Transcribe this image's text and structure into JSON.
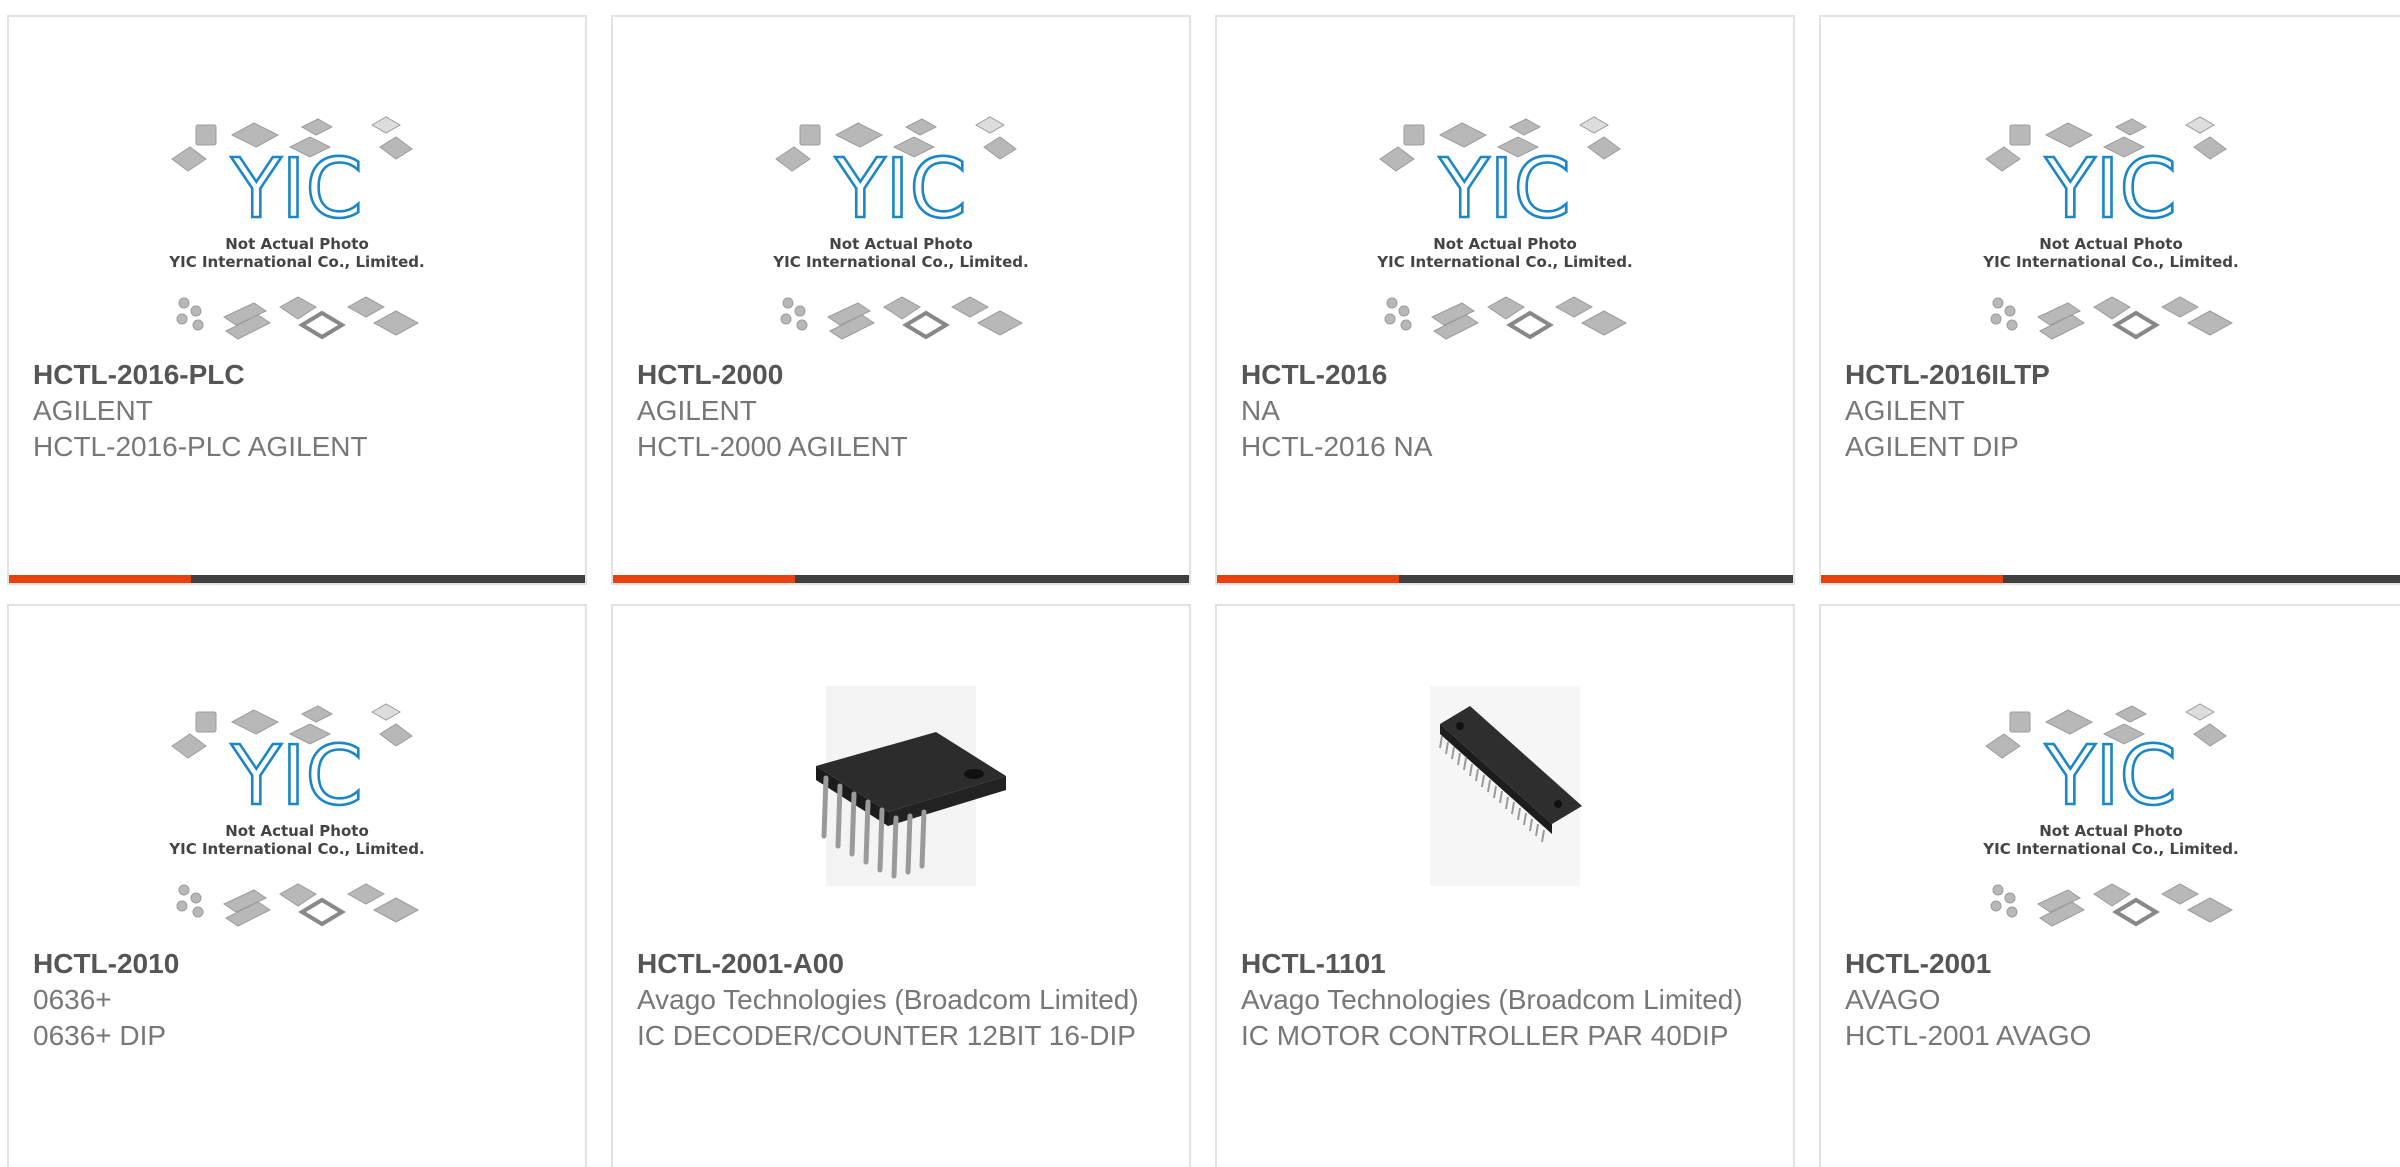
{
  "placeholder": {
    "logo": "YIC",
    "line1": "Not Actual Photo",
    "line2": "YIC International Co., Limited."
  },
  "colors": {
    "accent": "#e8410f",
    "bar": "#3f3f3f",
    "logo": "#1d86c6"
  },
  "products": [
    {
      "part": "HCTL-2016-PLC",
      "manufacturer": "AGILENT",
      "description": "HCTL-2016-PLC AGILENT",
      "image": "yic-placeholder"
    },
    {
      "part": "HCTL-2000",
      "manufacturer": "AGILENT",
      "description": "HCTL-2000 AGILENT",
      "image": "yic-placeholder"
    },
    {
      "part": "HCTL-2016",
      "manufacturer": "NA",
      "description": "HCTL-2016 NA",
      "image": "yic-placeholder"
    },
    {
      "part": "HCTL-2016ILTP",
      "manufacturer": "AGILENT",
      "description": "AGILENT DIP",
      "image": "yic-placeholder"
    },
    {
      "part": "HCTL-2010",
      "manufacturer": "0636+",
      "description": "0636+ DIP",
      "image": "yic-placeholder"
    },
    {
      "part": "HCTL-2001-A00",
      "manufacturer": "Avago Technologies (Broadcom Limited)",
      "description": "IC DECODER/COUNTER 12BIT 16-DIP",
      "image": "dip16-chip"
    },
    {
      "part": "HCTL-1101",
      "manufacturer": "Avago Technologies (Broadcom Limited)",
      "description": "IC MOTOR CONTROLLER PAR 40DIP",
      "image": "dip40-chip"
    },
    {
      "part": "HCTL-2001",
      "manufacturer": "AVAGO",
      "description": "HCTL-2001 AVAGO",
      "image": "yic-placeholder"
    }
  ]
}
